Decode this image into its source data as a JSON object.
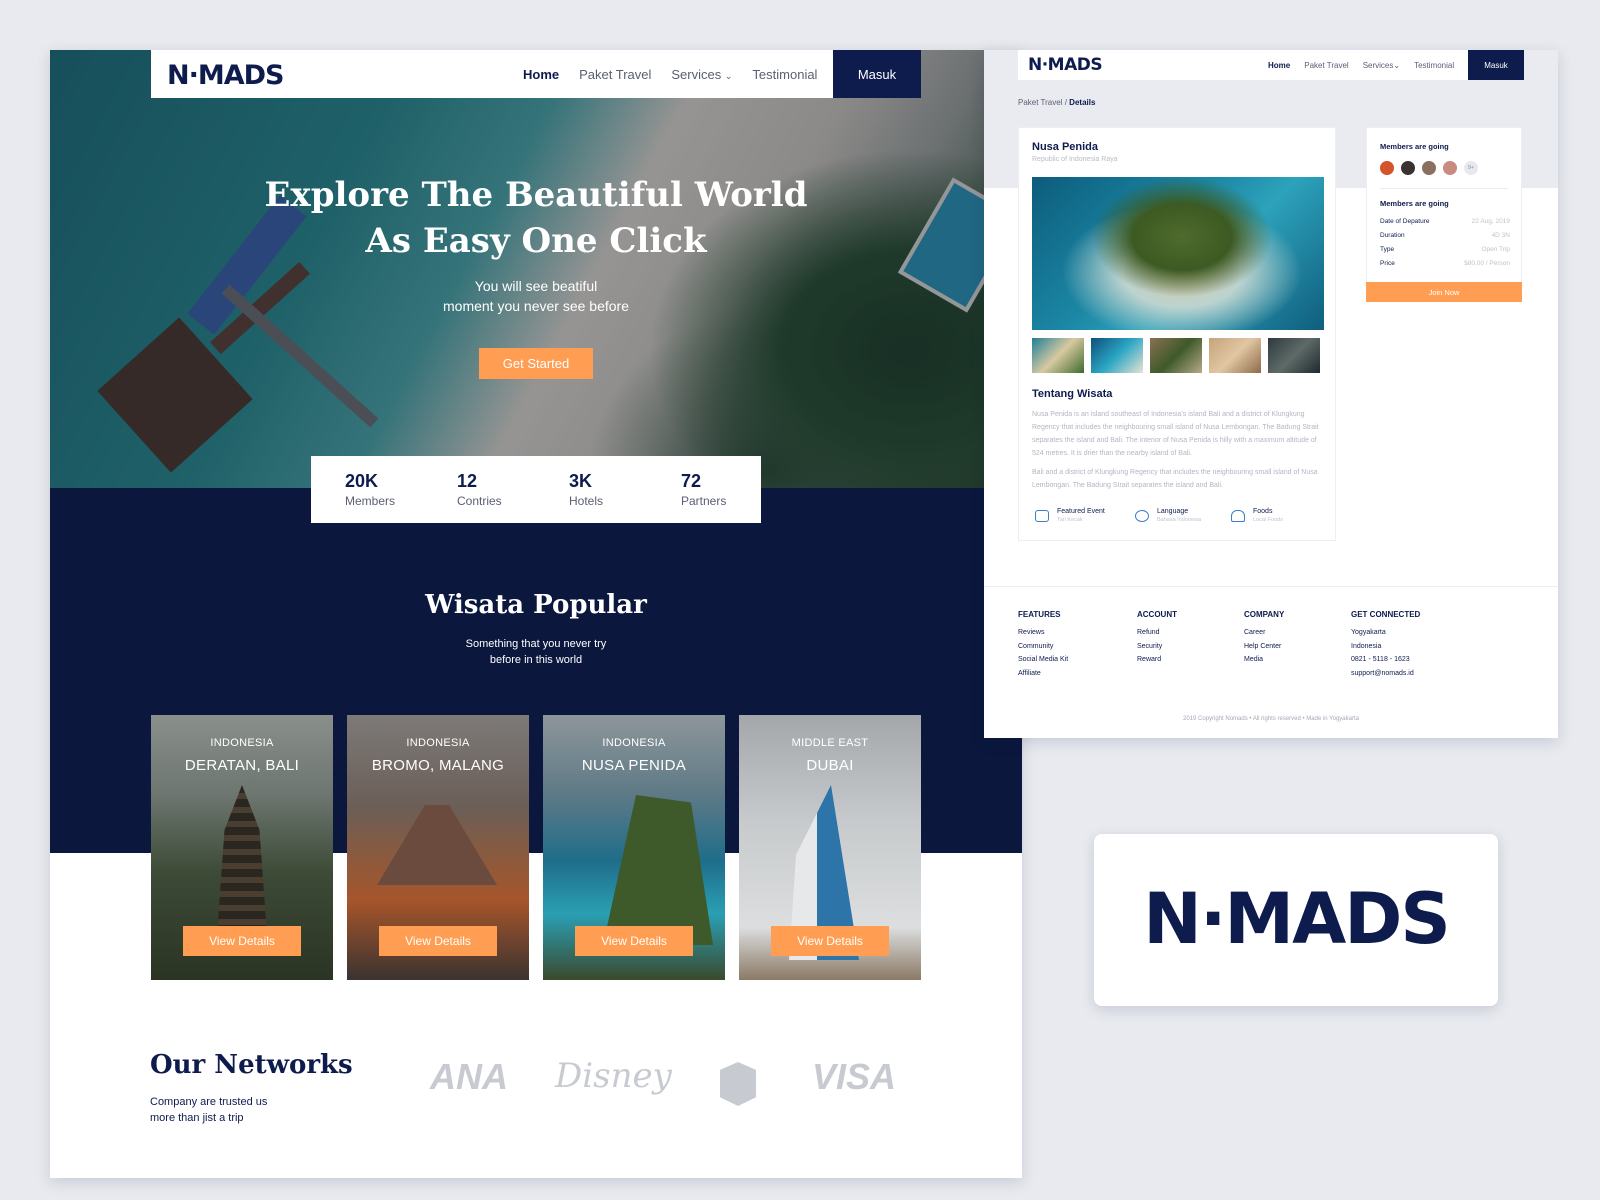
{
  "landing": {
    "logo": "N·MADS",
    "nav": {
      "home": "Home",
      "paket": "Paket Travel",
      "services": "Services",
      "testimonial": "Testimonial",
      "masuk": "Masuk"
    },
    "hero": {
      "title_line1": "Explore The Beautiful World",
      "title_line2": "As Easy One Click",
      "sub_line1": "You will see beatiful",
      "sub_line2": "moment you never see before",
      "cta": "Get Started"
    },
    "stats": [
      {
        "value": "20K",
        "label": "Members"
      },
      {
        "value": "12",
        "label": "Contries"
      },
      {
        "value": "3K",
        "label": "Hotels"
      },
      {
        "value": "72",
        "label": "Partners"
      }
    ],
    "popular": {
      "title": "Wisata Popular",
      "sub_line1": "Something that you never try",
      "sub_line2": "before in this world"
    },
    "cards": [
      {
        "country": "INDONESIA",
        "city": "DERATAN, BALI",
        "button": "View Details"
      },
      {
        "country": "INDONESIA",
        "city": "BROMO, MALANG",
        "button": "View Details"
      },
      {
        "country": "INDONESIA",
        "city": "NUSA PENIDA",
        "button": "View Details"
      },
      {
        "country": "MIDDLE EAST",
        "city": "DUBAI",
        "button": "View Details"
      }
    ],
    "networks": {
      "title": "Our Networks",
      "sub_line1": "Company are trusted us",
      "sub_line2": "more than jist a trip",
      "brands": [
        "ANA",
        "Disney",
        "VISA"
      ]
    }
  },
  "details": {
    "logo": "N·MADS",
    "nav": {
      "home": "Home",
      "paket": "Paket Travel",
      "services": "Services",
      "testimonial": "Testimonial",
      "masuk": "Masuk"
    },
    "breadcrumb": {
      "parent": "Paket Travel",
      "sep": "/",
      "current": "Details"
    },
    "place": {
      "title": "Nusa Penida",
      "subtitle": "Republic of Indonesia Raya"
    },
    "about": {
      "title": "Tentang Wisata",
      "para1": "Nusa Penida is an island southeast of Indonesia's island Bali and a district of Klungkung Regency that includes the neighbouring small island of Nusa Lembongan. The Badung Strait separates the island and Bali. The interior of Nusa Penida is hilly with a maximum altitude of 524 metres. It is drier than the nearby island of Bali.",
      "para2": "Bali and a district of Klungkung Regency that includes the neighbouring small island of Nusa Lembongan. The Badung Strait separates the island and Bali."
    },
    "features": [
      {
        "title": "Featured Event",
        "sub": "Tari Kecak"
      },
      {
        "title": "Language",
        "sub": "Bahasa Indonesia"
      },
      {
        "title": "Foods",
        "sub": "Local Foods"
      }
    ],
    "sidebar": {
      "members_title": "Members are going",
      "more_badge": "9+",
      "info_title": "Members are going",
      "rows": [
        {
          "key": "Date of Depature",
          "value": "22 Aug, 2019"
        },
        {
          "key": "Duration",
          "value": "4D 3N"
        },
        {
          "key": "Type",
          "value": "Open Trip"
        },
        {
          "key": "Price",
          "value": "$80,00 / Person"
        }
      ],
      "join": "Join Now"
    },
    "footer": {
      "columns": [
        {
          "title": "FEATURES",
          "items": [
            "Reviews",
            "Community",
            "Social Media Kit",
            "Affiliate"
          ]
        },
        {
          "title": "ACCOUNT",
          "items": [
            "Refund",
            "Security",
            "Reward"
          ]
        },
        {
          "title": "COMPANY",
          "items": [
            "Career",
            "Help Center",
            "Media"
          ]
        },
        {
          "title": "GET CONNECTED",
          "items": [
            "Yogyakarta",
            "Indonesia",
            "0821 - 5118 - 1623",
            "support@nomads.id"
          ]
        }
      ],
      "copyright": "2019 Copyright Nomads • All rights reserved • Made in Yogyakarta"
    }
  },
  "logo_card": {
    "text": "N·MADS"
  },
  "colors": {
    "navy": "#0e1b4d",
    "orange": "#ff9e53",
    "background": "#e8eaf0"
  }
}
